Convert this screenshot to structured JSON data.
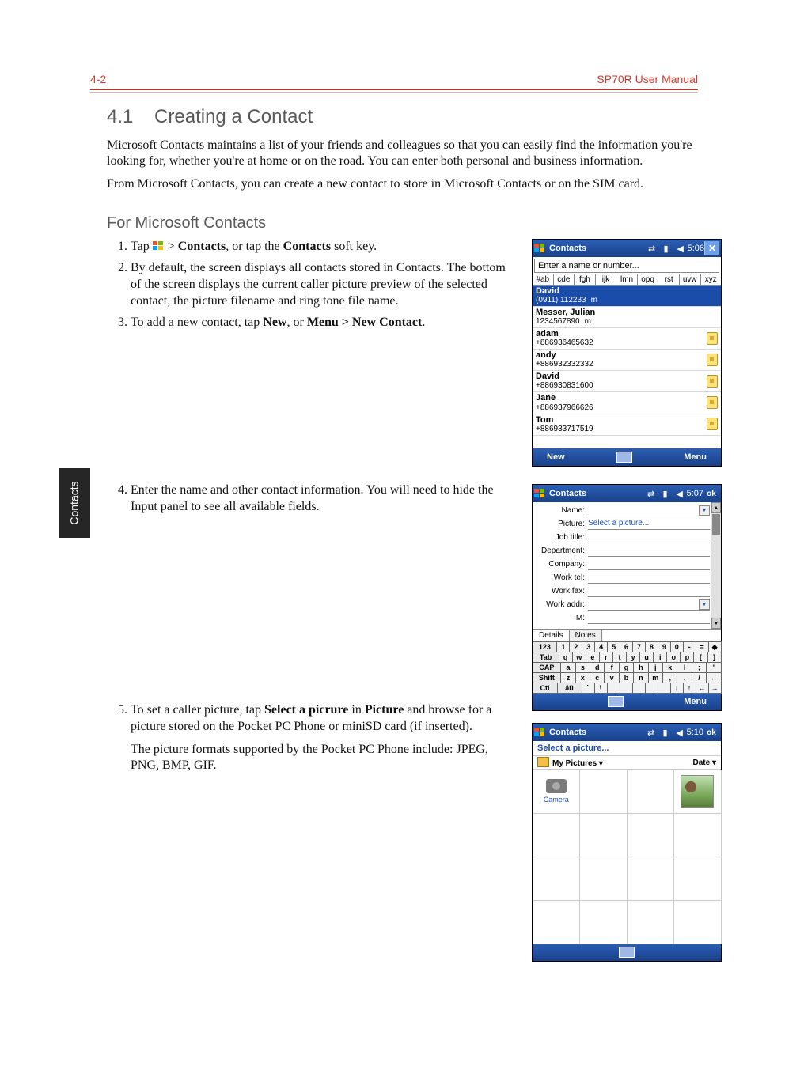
{
  "header": {
    "page_num": "4-2",
    "manual_title": "SP70R User Manual"
  },
  "side_tab": "Contacts",
  "section": {
    "number": "4.1",
    "title": "Creating a Contact"
  },
  "intro_p1": "Microsoft Contacts maintains a list of your friends and colleagues so that you can easily find the information you're looking for, whether you're at home or on the road. You can enter both personal and business information.",
  "intro_p2": "From Microsoft Contacts, you can create a new contact to store in Microsoft Contacts or on the SIM card.",
  "sub_heading": "For Microsoft Contacts",
  "steps": {
    "s1_pre": "Tap ",
    "s1_post_a": " > ",
    "s1_b1": "Contacts",
    "s1_mid": ", or tap the ",
    "s1_b2": "Contacts",
    "s1_post_b": " soft key.",
    "s2": "By default, the screen displays all contacts stored in Contacts. The bottom of the screen displays the current caller picture preview of the selected contact, the picture filename and ring tone file name.",
    "s3_pre": "To add a new contact, tap ",
    "s3_b1": "New",
    "s3_mid": ", or ",
    "s3_b2": "Menu > New Contact",
    "s3_post": ".",
    "s4": "Enter the name and other contact information. You will need to hide the Input panel to see all available fields.",
    "s5_pre": "To set a caller picture, tap ",
    "s5_b1": "Select a picrure",
    "s5_mid": " in ",
    "s5_b2": "Picture",
    "s5_post": " and browse for a picture stored on the Pocket PC Phone or miniSD card (if inserted).",
    "s5_p2": "The picture formats supported by the Pocket PC Phone include: JPEG, PNG, BMP, GIF."
  },
  "device1": {
    "title": "Contacts",
    "time": "5:06",
    "search_placeholder": "Enter a name or number...",
    "alpha": [
      "#ab",
      "cde",
      "fgh",
      "ijk",
      "lmn",
      "opq",
      "rst",
      "uvw",
      "xyz"
    ],
    "rows": [
      {
        "name": "David",
        "num": "(0911) 112233",
        "tag": "m",
        "sel": true,
        "sim": false
      },
      {
        "name": "Messer, Julian",
        "num": "1234567890",
        "tag": "m",
        "sel": false,
        "sim": false
      },
      {
        "name": "adam",
        "num": "+886936465632",
        "tag": "",
        "sel": false,
        "sim": true
      },
      {
        "name": "andy",
        "num": "+886932332332",
        "tag": "",
        "sel": false,
        "sim": true
      },
      {
        "name": "David",
        "num": "+886930831600",
        "tag": "",
        "sel": false,
        "sim": true
      },
      {
        "name": "Jane",
        "num": "+886937966626",
        "tag": "",
        "sel": false,
        "sim": true
      },
      {
        "name": "Tom",
        "num": "+886933717519",
        "tag": "",
        "sel": false,
        "sim": true
      }
    ],
    "soft_left": "New",
    "soft_right": "Menu"
  },
  "device2": {
    "title": "Contacts",
    "time": "5:07",
    "ok": "ok",
    "fields": [
      {
        "label": "Name:",
        "value": "",
        "dd": true
      },
      {
        "label": "Picture:",
        "value": "Select a picture...",
        "dd": false,
        "link": true
      },
      {
        "label": "Job title:",
        "value": ""
      },
      {
        "label": "Department:",
        "value": ""
      },
      {
        "label": "Company:",
        "value": ""
      },
      {
        "label": "Work tel:",
        "value": ""
      },
      {
        "label": "Work fax:",
        "value": ""
      },
      {
        "label": "Work addr:",
        "value": "",
        "dd": true
      },
      {
        "label": "IM:",
        "value": ""
      }
    ],
    "tabs": [
      "Details",
      "Notes"
    ],
    "kbd_rows": [
      [
        "123",
        "1",
        "2",
        "3",
        "4",
        "5",
        "6",
        "7",
        "8",
        "9",
        "0",
        "-",
        "=",
        "◆"
      ],
      [
        "Tab",
        "q",
        "w",
        "e",
        "r",
        "t",
        "y",
        "u",
        "i",
        "o",
        "p",
        "[",
        "]"
      ],
      [
        "CAP",
        "a",
        "s",
        "d",
        "f",
        "g",
        "h",
        "j",
        "k",
        "l",
        ";",
        "'"
      ],
      [
        "Shift",
        "z",
        "x",
        "c",
        "v",
        "b",
        "n",
        "m",
        ",",
        ".",
        "/",
        "←"
      ],
      [
        "Ctl",
        "áü",
        "`",
        "\\",
        "",
        "",
        "",
        "",
        "",
        "↓",
        "↑",
        "←",
        "→"
      ]
    ],
    "soft_right": "Menu"
  },
  "device3": {
    "title": "Contacts",
    "time": "5:10",
    "ok": "ok",
    "prompt": "Select a picture...",
    "folder_label": "My Pictures",
    "sort_label": "Date",
    "camera_label": "Camera"
  }
}
